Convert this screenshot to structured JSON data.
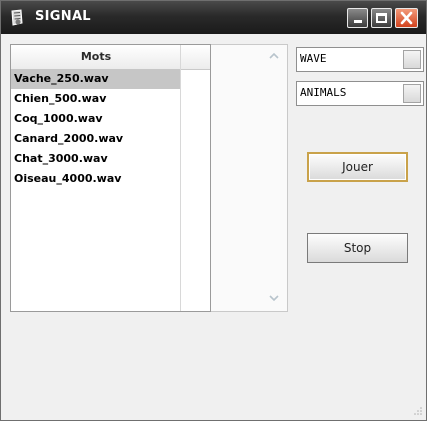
{
  "window": {
    "title": "SIGNAL",
    "icon": "app-icon",
    "controls": {
      "minimize": "minimize-icon",
      "maximize": "maximize-icon",
      "close": "close-icon"
    }
  },
  "list": {
    "column_header": "Mots",
    "items": [
      {
        "label": "Vache_250.wav",
        "selected": true
      },
      {
        "label": "Chien_500.wav",
        "selected": false
      },
      {
        "label": "Coq_1000.wav",
        "selected": false
      },
      {
        "label": "Canard_2000.wav",
        "selected": false
      },
      {
        "label": "Chat_3000.wav",
        "selected": false
      },
      {
        "label": "Oiseau_4000.wav",
        "selected": false
      }
    ]
  },
  "controls": {
    "format_select": {
      "value": "WAVE"
    },
    "category_select": {
      "value": "ANIMALS"
    },
    "play_label": "Jouer",
    "stop_label": "Stop"
  },
  "colors": {
    "titlebar": "#2a2a2a",
    "close_button": "#d2431e",
    "selected_row": "#c6c6c6",
    "focus_border": "#c9a24a"
  }
}
